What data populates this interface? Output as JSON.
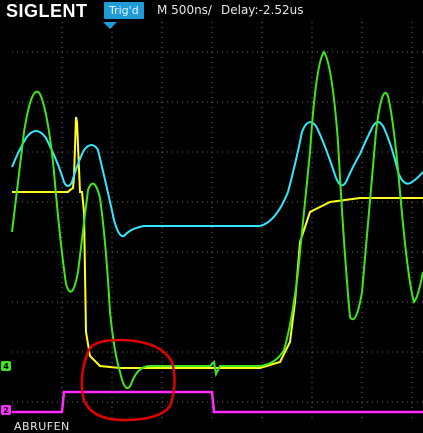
{
  "header": {
    "brand": "SIGLENT",
    "trigger_status": "Trig'd",
    "timebase": "M 500ns/",
    "delay": "Delay:-2.52us"
  },
  "channel_markers": [
    {
      "label": "4",
      "color": "#3ee61a"
    },
    {
      "label": "2",
      "color": "#ff2bff"
    }
  ],
  "footer": {
    "label": "ABRUFEN"
  },
  "colors": {
    "yellow": "#ffff1a",
    "cyan": "#33e6ff",
    "green": "#3ee61a",
    "magenta": "#ff2bff",
    "annotation": "#e00000",
    "trigger_accent": "#1f9bd8",
    "grid": "#6b6b6b"
  },
  "icons": {
    "trigger_position": "trigger-pointer-icon",
    "annotation": "red-circle-annotation"
  }
}
